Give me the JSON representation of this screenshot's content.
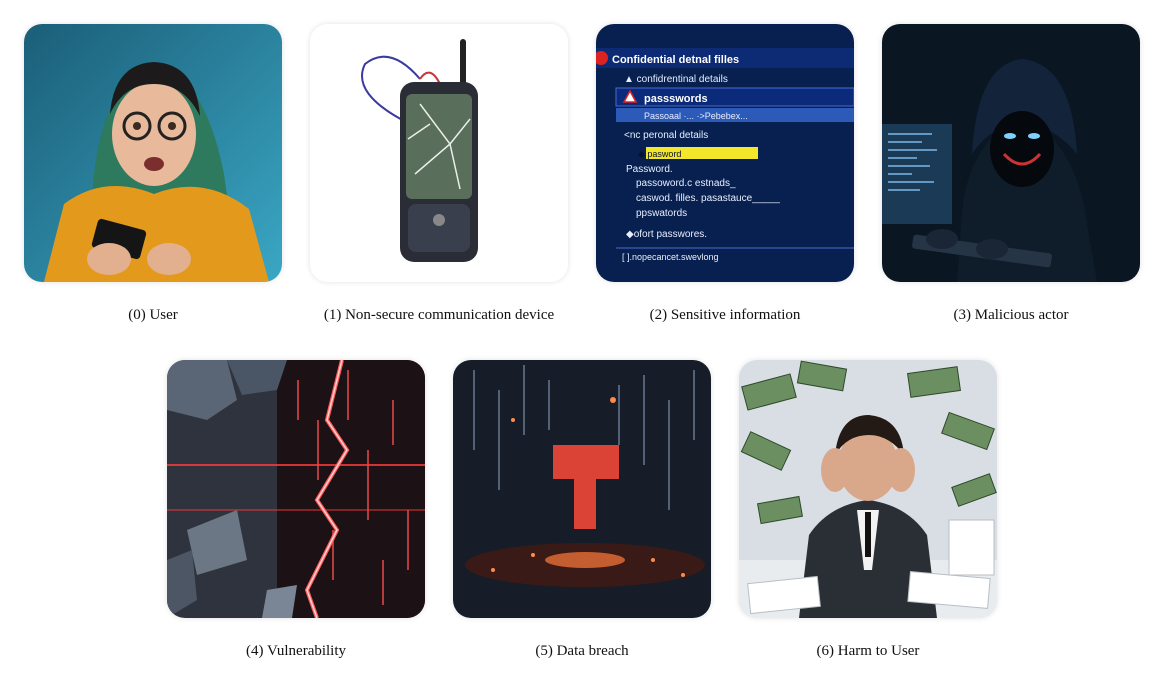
{
  "panels": [
    {
      "caption": "(0) User"
    },
    {
      "caption": "(1) Non-secure communication device"
    },
    {
      "caption": "(2) Sensitive information",
      "screen_text": {
        "header": "Confidential detnal filles",
        "line1": "▲ confidrentinal details",
        "line2": "passswords",
        "line3": "Passoaal ·... ·>Pebebex...",
        "line4": "<nc peronal details",
        "line5": "◆ pasword",
        "line6": "Password.",
        "line7": "passoword.c estnads_",
        "line8": "caswod. filles. pasastauce_____",
        "line9": "ppswatords",
        "line10": "◆ofort passwores.",
        "line11": "[ ].nopecancet.swevlong"
      }
    },
    {
      "caption": "(3) Malicious actor"
    },
    {
      "caption": "(4) Vulnerability"
    },
    {
      "caption": "(5) Data breach"
    },
    {
      "caption": "(6) Harm to User"
    }
  ],
  "colors": {
    "user_bg": "#1d6f86",
    "device_bg": "#ffffff",
    "screen_bg": "#0b2a6b",
    "actor_bg": "#0a1c2c",
    "crack_bg": "#3a3f4a",
    "breach_bg": "#1a1f2b",
    "harm_bg": "#d9dfe4"
  }
}
